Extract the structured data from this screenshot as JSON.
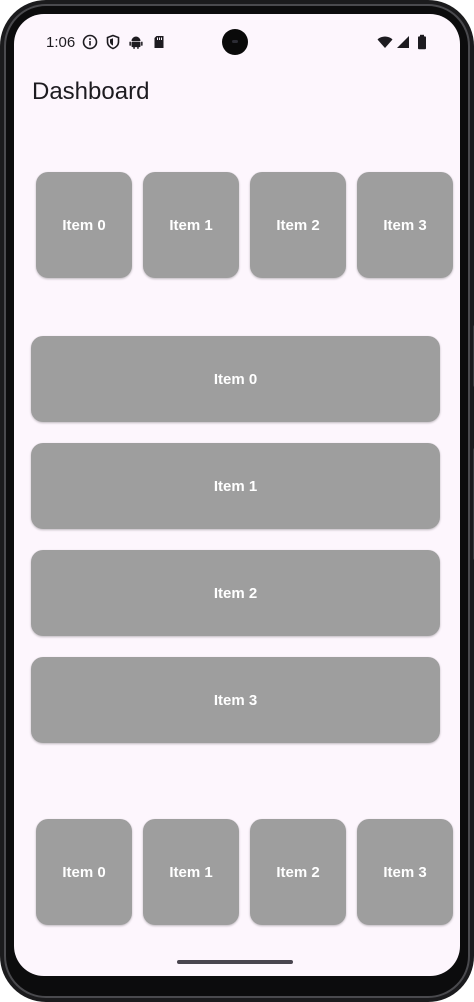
{
  "status_bar": {
    "time": "1:06",
    "icons": [
      "info-icon",
      "shield-icon",
      "android-icon",
      "sd-card-icon",
      "wifi-icon",
      "signal-icon",
      "battery-icon"
    ]
  },
  "page": {
    "title": "Dashboard"
  },
  "top_row": {
    "items": [
      {
        "label": "Item 0"
      },
      {
        "label": "Item 1"
      },
      {
        "label": "Item 2"
      },
      {
        "label": "Item 3"
      }
    ]
  },
  "list": {
    "items": [
      {
        "label": "Item 0"
      },
      {
        "label": "Item 1"
      },
      {
        "label": "Item 2"
      },
      {
        "label": "Item 3"
      }
    ]
  },
  "bottom_row": {
    "items": [
      {
        "label": "Item 0"
      },
      {
        "label": "Item 1"
      },
      {
        "label": "Item 2"
      },
      {
        "label": "Item 3"
      }
    ]
  },
  "colors": {
    "background": "#fdf6fd",
    "tile": "#9e9e9e",
    "tile_text": "#ffffff",
    "title_text": "#1d1b20"
  }
}
